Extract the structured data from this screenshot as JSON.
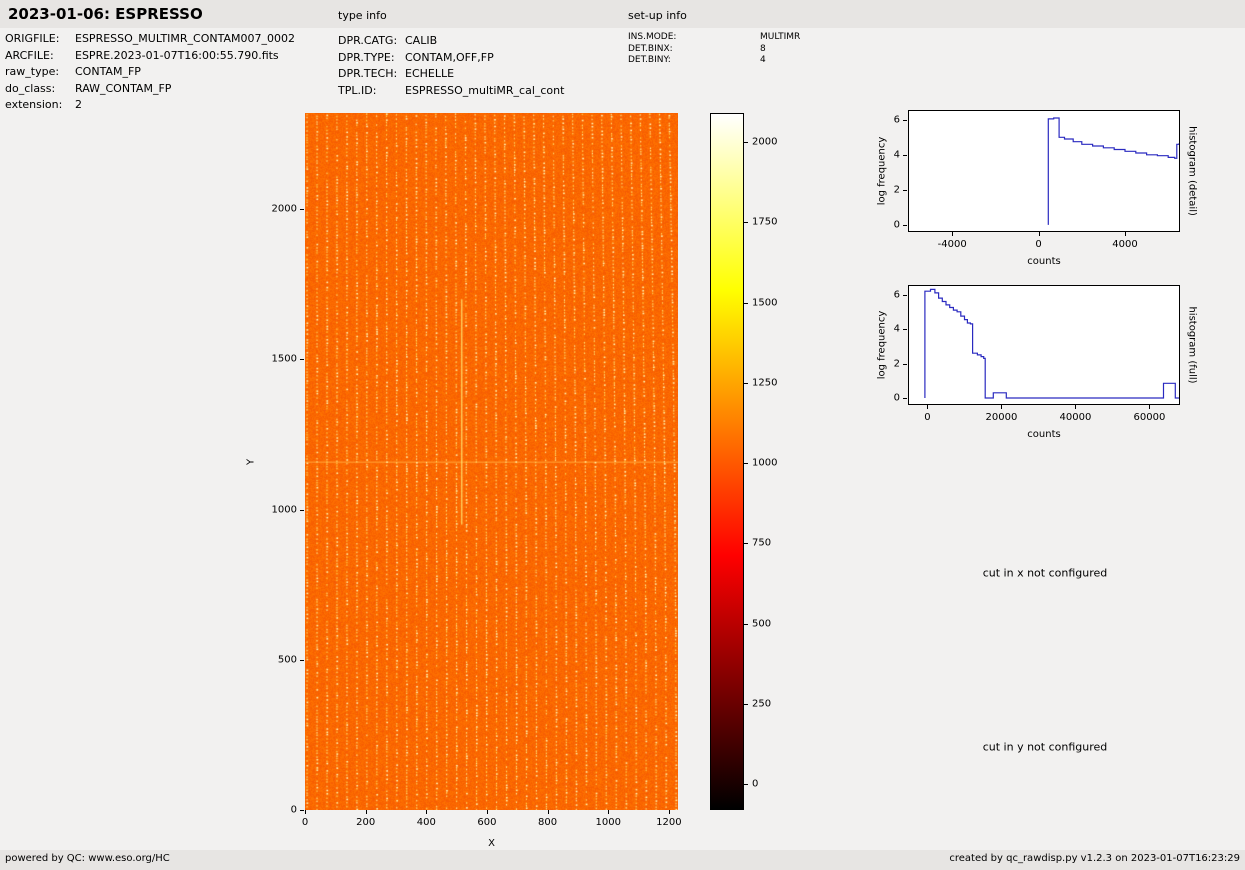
{
  "header": {
    "title": "2023-01-06: ESPRESSO",
    "type_info_label": "type info",
    "setup_info_label": "set-up info"
  },
  "metadata": {
    "file": [
      {
        "label": "ORIGFILE:",
        "value": "ESPRESSO_MULTIMR_CONTAM007_0002"
      },
      {
        "label": "ARCFILE:",
        "value": "ESPRE.2023-01-07T16:00:55.790.fits"
      },
      {
        "label": "raw_type:",
        "value": "CONTAM_FP"
      },
      {
        "label": "do_class:",
        "value": "RAW_CONTAM_FP"
      },
      {
        "label": "extension:",
        "value": "2"
      }
    ],
    "type_info": [
      {
        "label": "DPR.CATG:",
        "value": "CALIB"
      },
      {
        "label": "DPR.TYPE:",
        "value": "CONTAM,OFF,FP"
      },
      {
        "label": "DPR.TECH:",
        "value": "ECHELLE"
      },
      {
        "label": "TPL.ID:",
        "value": "ESPRESSO_multiMR_cal_cont"
      }
    ],
    "setup_info": [
      {
        "label": "INS.MODE:",
        "value": "MULTIMR"
      },
      {
        "label": "DET.BINX:",
        "value": "8"
      },
      {
        "label": "DET.BINY:",
        "value": "4"
      }
    ]
  },
  "notes": {
    "cut_x": "cut in x not configured",
    "cut_y": "cut in y not configured"
  },
  "footer": {
    "left": "powered by QC: www.eso.org/HC",
    "right": "created by qc_rawdisp.py v1.2.3 on 2023-01-07T16:23:29"
  },
  "chart_data": [
    {
      "id": "raw_frame",
      "type": "heatmap",
      "xlabel": "X",
      "ylabel": "Y",
      "xlim": [
        0,
        1230
      ],
      "ylim": [
        0,
        2320
      ],
      "xticks": [
        0,
        200,
        400,
        600,
        800,
        1000,
        1200
      ],
      "yticks": [
        0,
        500,
        1000,
        1500,
        2000
      ],
      "colormap": "hot",
      "description": "ESPRESSO raw multiMR CONTAM_FP echelle frame: ~38 nearly vertical dotted Fabry-Perot order stripes of bright yellow dots (~1500-2100 counts) on an orange background (~1000 counts), slight curvature increasing toward the right edge, bright horizontal detector row near Y=1160 and a short bright vertical feature near X=515",
      "n_stripes": 38,
      "background_value": 1000,
      "stripe_value": 1700,
      "horizontal_feature_y": 1160,
      "vertical_feature": {
        "x": 515,
        "y_from": 950,
        "y_to": 1700
      }
    },
    {
      "id": "colorbar",
      "type": "colorbar",
      "vmin": -80,
      "vmax": 2090,
      "ticks": [
        0,
        250,
        500,
        750,
        1000,
        1250,
        1500,
        1750,
        2000
      ],
      "colormap_stops": [
        {
          "pos": 0.0,
          "color": "#000000"
        },
        {
          "pos": 0.365,
          "color": "#ff0000"
        },
        {
          "pos": 0.746,
          "color": "#ffff00"
        },
        {
          "pos": 1.0,
          "color": "#ffffff"
        }
      ]
    },
    {
      "id": "histogram_detail",
      "type": "line",
      "right_label": "histogram (detail)",
      "xlabel": "counts",
      "ylabel": "log frequency",
      "xlim": [
        -6000,
        6500
      ],
      "ylim": [
        -0.35,
        6.5
      ],
      "xticks": [
        -4000,
        0,
        4000
      ],
      "yticks": [
        0,
        2,
        4,
        6
      ],
      "line_color": "#2a2ac0",
      "step": true,
      "points": [
        [
          450,
          0
        ],
        [
          450,
          6.05
        ],
        [
          700,
          6.1
        ],
        [
          850,
          6.1
        ],
        [
          950,
          5.0
        ],
        [
          1200,
          4.9
        ],
        [
          1600,
          4.75
        ],
        [
          2000,
          4.6
        ],
        [
          2500,
          4.5
        ],
        [
          3000,
          4.4
        ],
        [
          3500,
          4.3
        ],
        [
          4000,
          4.2
        ],
        [
          4500,
          4.1
        ],
        [
          5000,
          4.0
        ],
        [
          5500,
          3.95
        ],
        [
          6000,
          3.85
        ],
        [
          6300,
          3.8
        ],
        [
          6400,
          4.6
        ],
        [
          6500,
          4.65
        ]
      ]
    },
    {
      "id": "histogram_full",
      "type": "line",
      "right_label": "histogram (full)",
      "xlabel": "counts",
      "ylabel": "log frequency",
      "xlim": [
        -5000,
        68000
      ],
      "ylim": [
        -0.35,
        6.5
      ],
      "xticks": [
        0,
        20000,
        40000,
        60000
      ],
      "yticks": [
        0,
        2,
        4,
        6
      ],
      "line_color": "#2a2ac0",
      "step": true,
      "points": [
        [
          -700,
          0
        ],
        [
          -700,
          6.2
        ],
        [
          800,
          6.3
        ],
        [
          2000,
          6.1
        ],
        [
          3000,
          5.8
        ],
        [
          4000,
          5.6
        ],
        [
          5000,
          5.4
        ],
        [
          6000,
          5.25
        ],
        [
          7000,
          5.1
        ],
        [
          8000,
          5.0
        ],
        [
          9000,
          4.75
        ],
        [
          10000,
          4.55
        ],
        [
          10800,
          4.35
        ],
        [
          11600,
          4.3
        ],
        [
          12200,
          2.6
        ],
        [
          13500,
          2.5
        ],
        [
          14500,
          2.4
        ],
        [
          15200,
          2.3
        ],
        [
          15600,
          0
        ],
        [
          17500,
          0
        ],
        [
          17800,
          0.3
        ],
        [
          21000,
          0.3
        ],
        [
          21300,
          0
        ],
        [
          63500,
          0
        ],
        [
          63800,
          0.85
        ],
        [
          66800,
          0.85
        ],
        [
          67000,
          0
        ],
        [
          68000,
          0
        ]
      ]
    }
  ]
}
